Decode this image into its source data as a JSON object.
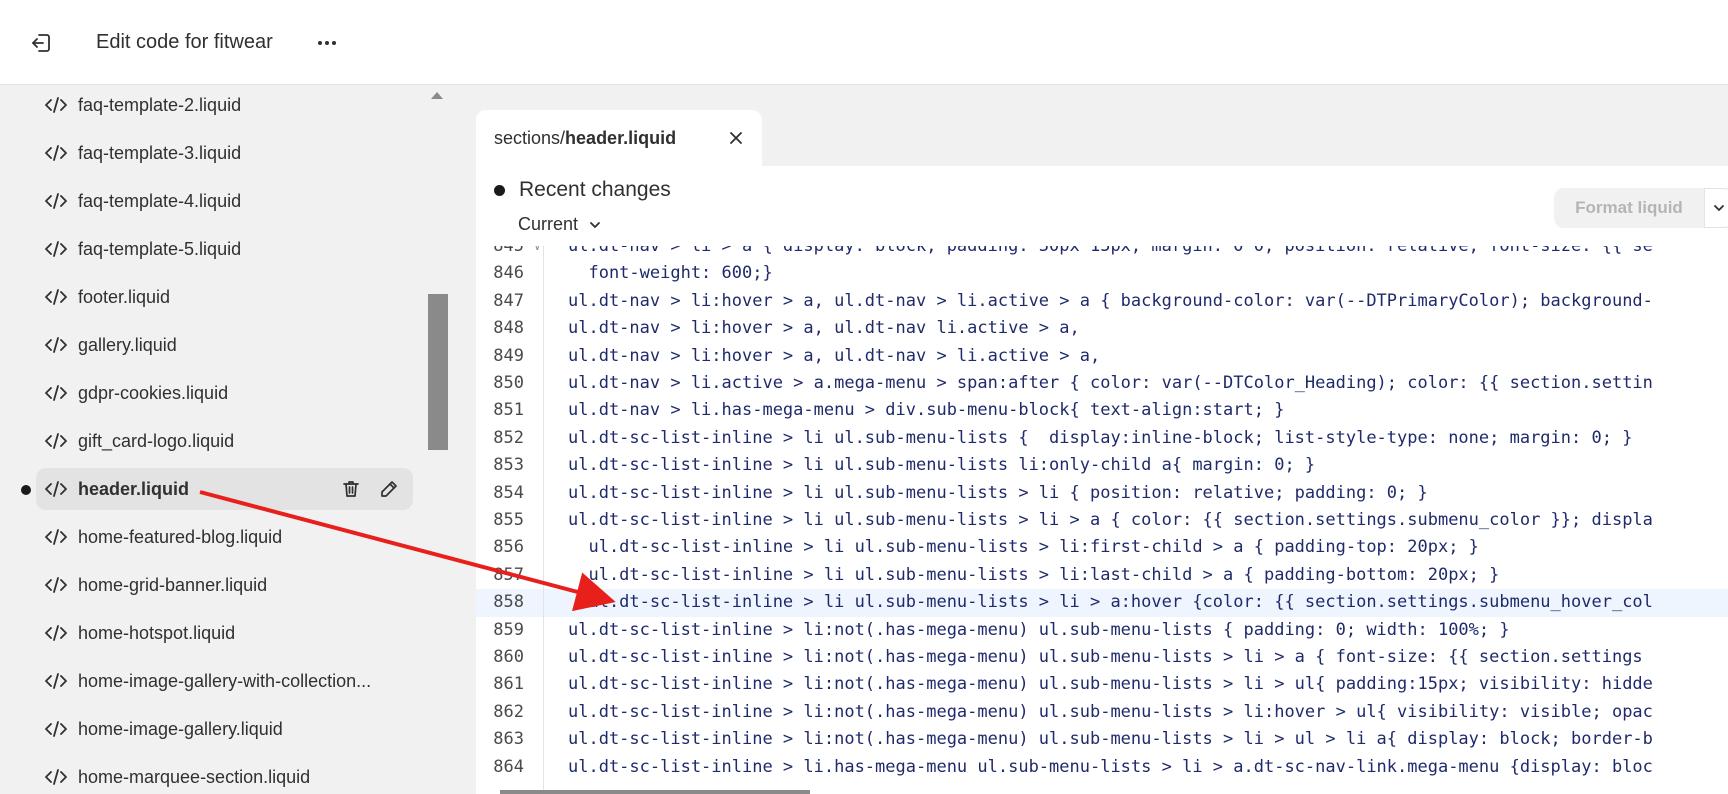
{
  "header": {
    "title": "Edit code for fitwear",
    "exit_icon": "exit-icon",
    "more_icon": "more-horizontal-icon"
  },
  "sidebar": {
    "files": [
      {
        "name": "faq-template-2.liquid",
        "active": false
      },
      {
        "name": "faq-template-3.liquid",
        "active": false
      },
      {
        "name": "faq-template-4.liquid",
        "active": false
      },
      {
        "name": "faq-template-5.liquid",
        "active": false
      },
      {
        "name": "footer.liquid",
        "active": false
      },
      {
        "name": "gallery.liquid",
        "active": false
      },
      {
        "name": "gdpr-cookies.liquid",
        "active": false
      },
      {
        "name": "gift_card-logo.liquid",
        "active": false
      },
      {
        "name": "header.liquid",
        "active": true
      },
      {
        "name": "home-featured-blog.liquid",
        "active": false
      },
      {
        "name": "home-grid-banner.liquid",
        "active": false
      },
      {
        "name": "home-hotspot.liquid",
        "active": false
      },
      {
        "name": "home-image-gallery-with-collection...",
        "active": false
      },
      {
        "name": "home-image-gallery.liquid",
        "active": false
      },
      {
        "name": "home-marquee-section.liquid",
        "active": false
      }
    ]
  },
  "editor": {
    "tab": {
      "folder": "sections/",
      "file": "header.liquid"
    },
    "recent_changes": "Recent changes",
    "current": "Current",
    "format_button": "Format liquid",
    "lines": [
      {
        "n": "845",
        "text": "ul.dt-nav > li > a { display: block; padding: 30px 15px; margin: 0 0; position: relative; font-size: {{ se",
        "fold": true
      },
      {
        "n": "846",
        "text": "  font-weight: 600;}"
      },
      {
        "n": "847",
        "text": "ul.dt-nav > li:hover > a, ul.dt-nav > li.active > a { background-color: var(--DTPrimaryColor); background-"
      },
      {
        "n": "848",
        "text": "ul.dt-nav > li:hover > a, ul.dt-nav li.active > a,"
      },
      {
        "n": "849",
        "text": "ul.dt-nav > li:hover > a, ul.dt-nav > li.active > a,"
      },
      {
        "n": "850",
        "text": "ul.dt-nav > li.active > a.mega-menu > span:after { color: var(--DTColor_Heading); color: {{ section.settin"
      },
      {
        "n": "851",
        "text": "ul.dt-nav > li.has-mega-menu > div.sub-menu-block{ text-align:start; }"
      },
      {
        "n": "852",
        "text": "ul.dt-sc-list-inline > li ul.sub-menu-lists {  display:inline-block; list-style-type: none; margin: 0; }"
      },
      {
        "n": "853",
        "text": "ul.dt-sc-list-inline > li ul.sub-menu-lists li:only-child a{ margin: 0; }"
      },
      {
        "n": "854",
        "text": "ul.dt-sc-list-inline > li ul.sub-menu-lists > li { position: relative; padding: 0; }"
      },
      {
        "n": "855",
        "text": "ul.dt-sc-list-inline > li ul.sub-menu-lists > li > a { color: {{ section.settings.submenu_color }}; displa"
      },
      {
        "n": "856",
        "text": "  ul.dt-sc-list-inline > li ul.sub-menu-lists > li:first-child > a { padding-top: 20px; }"
      },
      {
        "n": "857",
        "text": "  ul.dt-sc-list-inline > li ul.sub-menu-lists > li:last-child > a { padding-bottom: 20px; }"
      },
      {
        "n": "858",
        "text": "  ul.dt-sc-list-inline > li ul.sub-menu-lists > li > a:hover {color: {{ section.settings.submenu_hover_col",
        "highlight": true
      },
      {
        "n": "859",
        "text": "ul.dt-sc-list-inline > li:not(.has-mega-menu) ul.sub-menu-lists { padding: 0; width: 100%; }"
      },
      {
        "n": "860",
        "text": "ul.dt-sc-list-inline > li:not(.has-mega-menu) ul.sub-menu-lists > li > a { font-size: {{ section.settings"
      },
      {
        "n": "861",
        "text": "ul.dt-sc-list-inline > li:not(.has-mega-menu) ul.sub-menu-lists > li > ul{ padding:15px; visibility: hidde"
      },
      {
        "n": "862",
        "text": "ul.dt-sc-list-inline > li:not(.has-mega-menu) ul.sub-menu-lists > li:hover > ul{ visibility: visible; opac"
      },
      {
        "n": "863",
        "text": "ul.dt-sc-list-inline > li:not(.has-mega-menu) ul.sub-menu-lists > li > ul > li a{ display: block; border-b"
      },
      {
        "n": "864",
        "text": "ul.dt-sc-list-inline > li.has-mega-menu ul.sub-menu-lists > li > a.dt-sc-nav-link.mega-menu {display: bloc"
      }
    ]
  },
  "colors": {
    "annotation_arrow": "#e8201c",
    "highlight_line": "#eef5ff"
  }
}
